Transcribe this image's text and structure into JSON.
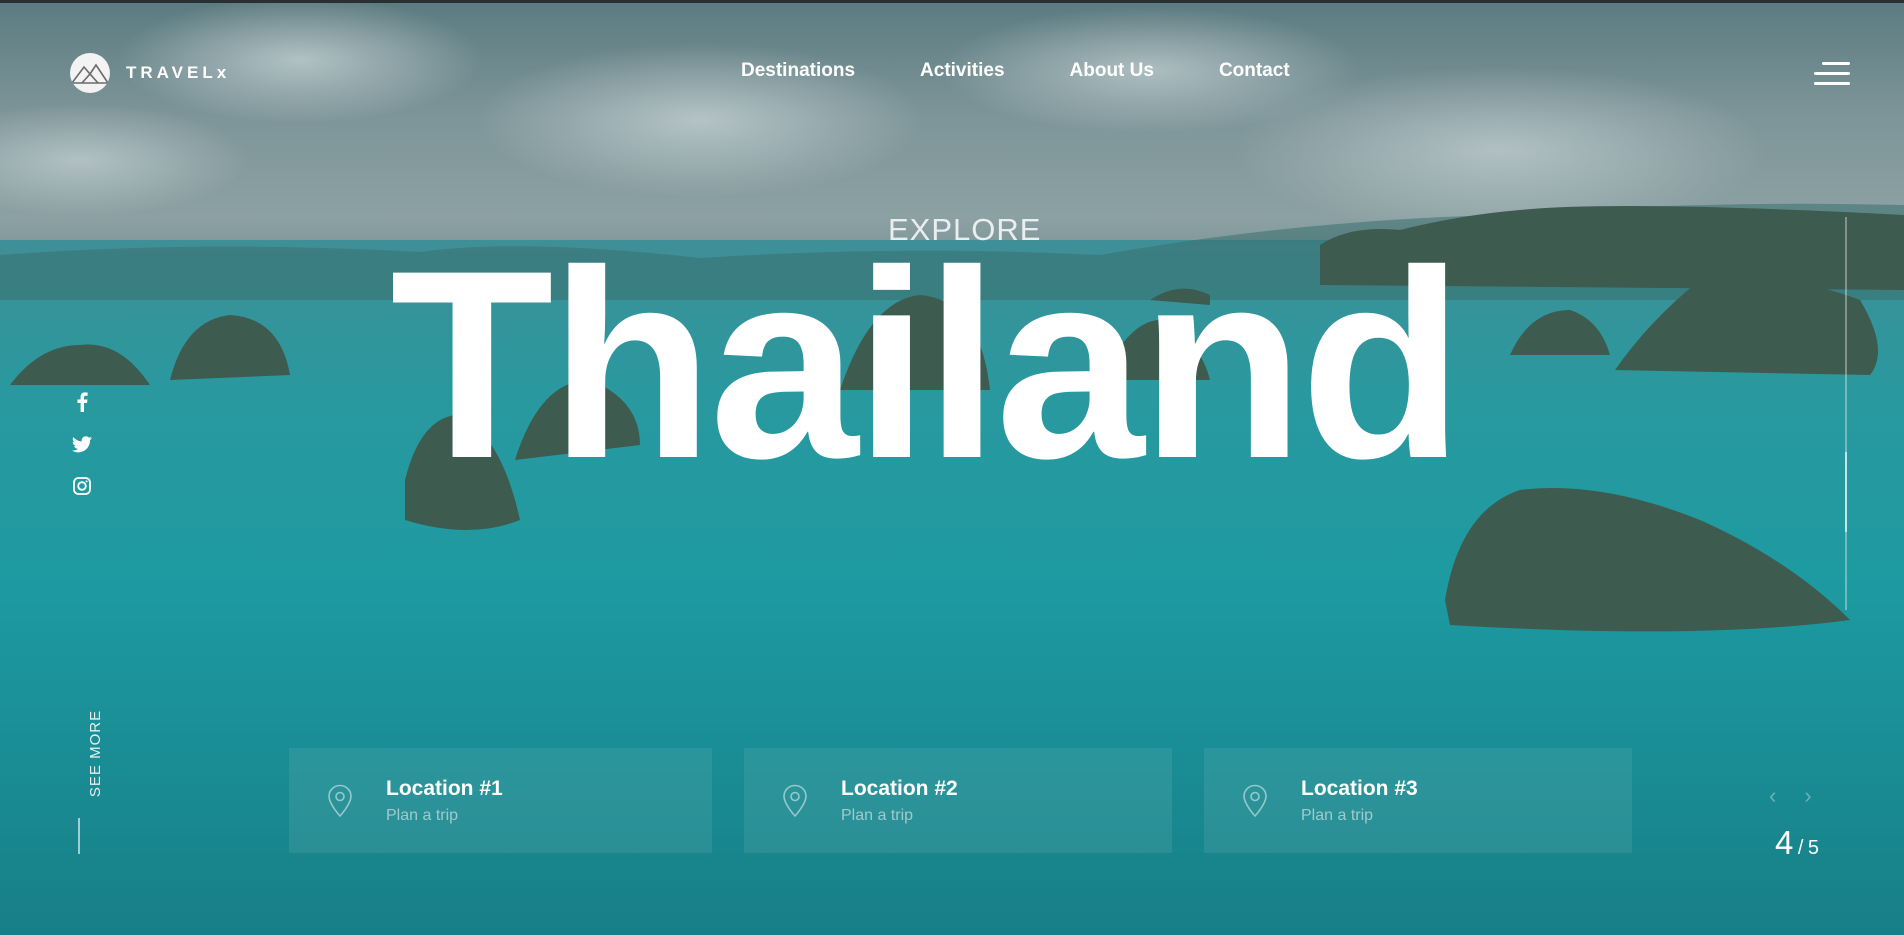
{
  "brand": {
    "name": "TRAVELx",
    "logo_icon": "mountain-icon"
  },
  "nav": {
    "items": [
      {
        "label": "Destinations"
      },
      {
        "label": "Activities"
      },
      {
        "label": "About Us"
      },
      {
        "label": "Contact"
      }
    ],
    "menu_icon": "hamburger-menu-icon"
  },
  "hero": {
    "eyebrow": "EXPLORE",
    "title": "Thailand"
  },
  "social": {
    "icons": [
      "facebook-icon",
      "twitter-icon",
      "instagram-icon"
    ]
  },
  "see_more": {
    "label": "SEE MORE"
  },
  "locations": [
    {
      "title": "Location #1",
      "subtitle": "Plan a trip"
    },
    {
      "title": "Location #2",
      "subtitle": "Plan a trip"
    },
    {
      "title": "Location #3",
      "subtitle": "Plan a trip"
    }
  ],
  "pager": {
    "current": "4",
    "separator": "/",
    "total": "5",
    "prev_icon": "chevron-left-icon",
    "next_icon": "chevron-right-icon"
  }
}
